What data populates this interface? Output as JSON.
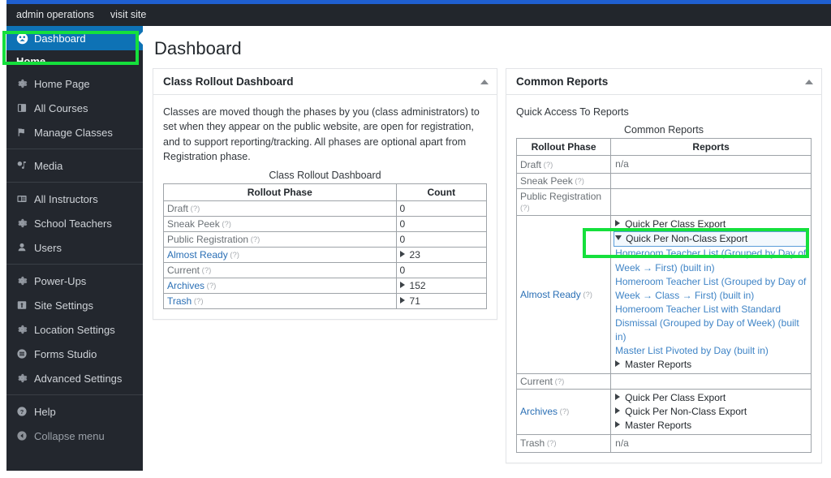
{
  "admin_bar": {
    "items": [
      {
        "label": "admin operations",
        "name": "admin-operations-menu"
      },
      {
        "label": "visit site",
        "name": "visit-site-link"
      }
    ]
  },
  "sidebar": {
    "active_item": {
      "label": "Dashboard",
      "icon": "dashboard-icon"
    },
    "section_header": "Home",
    "groups": [
      {
        "items": [
          {
            "label": "Home Page",
            "icon": "gear-icon"
          },
          {
            "label": "All Courses",
            "icon": "book-icon"
          },
          {
            "label": "Manage Classes",
            "icon": "flag-icon"
          }
        ]
      },
      {
        "items": [
          {
            "label": "Media",
            "icon": "media-icon"
          }
        ]
      },
      {
        "items": [
          {
            "label": "All Instructors",
            "icon": "id-card-icon"
          },
          {
            "label": "School Teachers",
            "icon": "gear-icon"
          },
          {
            "label": "Users",
            "icon": "user-icon"
          }
        ]
      },
      {
        "items": [
          {
            "label": "Power-Ups",
            "icon": "gear-icon"
          },
          {
            "label": "Site Settings",
            "icon": "sliders-icon"
          },
          {
            "label": "Location Settings",
            "icon": "gear-icon"
          },
          {
            "label": "Forms Studio",
            "icon": "forms-icon"
          },
          {
            "label": "Advanced Settings",
            "icon": "gear-icon"
          }
        ]
      },
      {
        "items": [
          {
            "label": "Help",
            "icon": "help-icon"
          },
          {
            "label": "Collapse menu",
            "icon": "collapse-icon",
            "dim": true
          }
        ]
      }
    ]
  },
  "page": {
    "title": "Dashboard"
  },
  "rollout_panel": {
    "title": "Class Rollout Dashboard",
    "description": "Classes are moved though the phases by you (class administrators) to set when they appear on the public website, are open for registration, and to support reporting/tracking. All phases are optional apart from Registration phase.",
    "table_caption": "Class Rollout Dashboard",
    "columns": [
      "Rollout Phase",
      "Count"
    ],
    "help_marker": "(?)",
    "rows": [
      {
        "phase": "Draft",
        "count": "0",
        "link": false,
        "expandable": false
      },
      {
        "phase": "Sneak Peek",
        "count": "0",
        "link": false,
        "expandable": false
      },
      {
        "phase": "Public Registration",
        "count": "0",
        "link": false,
        "expandable": false
      },
      {
        "phase": "Almost Ready",
        "count": "23",
        "link": true,
        "expandable": true
      },
      {
        "phase": "Current",
        "count": "0",
        "link": false,
        "expandable": false
      },
      {
        "phase": "Archives",
        "count": "152",
        "link": true,
        "expandable": true
      },
      {
        "phase": "Trash",
        "count": "71",
        "link": true,
        "expandable": true
      }
    ]
  },
  "reports_panel": {
    "title": "Common Reports",
    "subtitle": "Quick Access To Reports",
    "table_caption": "Common Reports",
    "columns": [
      "Rollout Phase",
      "Reports"
    ],
    "help_marker": "(?)",
    "na_text": "n/a",
    "rows": [
      {
        "phase": "Draft",
        "link": false,
        "reports": [
          {
            "text": "n/a",
            "kind": "na"
          }
        ]
      },
      {
        "phase": "Sneak Peek",
        "link": false,
        "reports": []
      },
      {
        "phase": "Public Registration",
        "link": false,
        "reports": []
      },
      {
        "phase": "Almost Ready",
        "link": true,
        "reports": [
          {
            "text": "Quick Per Class Export",
            "kind": "node-collapsed"
          },
          {
            "text": "Quick Per Non-Class Export",
            "kind": "node-expanded",
            "focused": true
          },
          {
            "text": "Homeroom Teacher List (Grouped by Day of Week → First) (built in)",
            "kind": "leaf"
          },
          {
            "text": "Homeroom Teacher List (Grouped by Day of Week → Class → First) (built in)",
            "kind": "leaf",
            "highlighted": true
          },
          {
            "text": "Homeroom Teacher List with Standard Dismissal (Grouped by Day of Week) (built in)",
            "kind": "leaf"
          },
          {
            "text": "Master List Pivoted by Day (built in)",
            "kind": "leaf"
          },
          {
            "text": "Master Reports",
            "kind": "node-collapsed"
          }
        ]
      },
      {
        "phase": "Current",
        "link": false,
        "reports": []
      },
      {
        "phase": "Archives",
        "link": true,
        "reports": [
          {
            "text": "Quick Per Class Export",
            "kind": "node-collapsed"
          },
          {
            "text": "Quick Per Non-Class Export",
            "kind": "node-collapsed"
          },
          {
            "text": "Master Reports",
            "kind": "node-collapsed"
          }
        ]
      },
      {
        "phase": "Trash",
        "link": false,
        "reports": [
          {
            "text": "n/a",
            "kind": "na"
          }
        ]
      }
    ]
  },
  "annotations": {
    "sidebar_highlight_color": "#15e03c",
    "report_highlight_color": "#15e03c",
    "accent_blue": "#0e72b5",
    "link_blue": "#2a6fb5"
  }
}
